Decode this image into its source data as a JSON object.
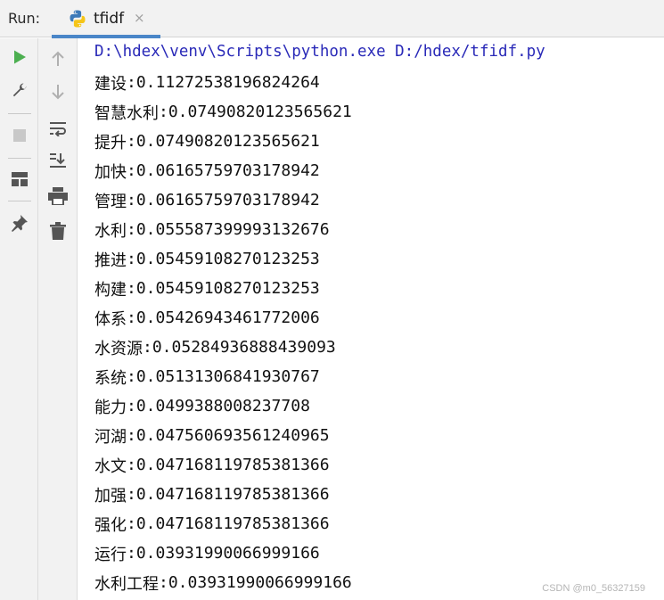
{
  "run_label": "Run:",
  "tab": {
    "title": "tfidf",
    "close": "×",
    "icon": "python-icon"
  },
  "left_toolbar": [
    "run-icon",
    "wrench-icon",
    "stop-icon",
    "layout-icon",
    "pin-icon"
  ],
  "right_toolbar": [
    "arrow-up-icon",
    "arrow-down-icon",
    "soft-wrap-icon",
    "scroll-to-end-icon",
    "print-icon",
    "trash-icon"
  ],
  "console": {
    "command": "D:\\hdex\\venv\\Scripts\\python.exe D:/hdex/tfidf.py",
    "lines": [
      {
        "term": "建设",
        "value": "0.11272538196824264"
      },
      {
        "term": "智慧水利",
        "value": "0.07490820123565621"
      },
      {
        "term": "提升",
        "value": "0.07490820123565621"
      },
      {
        "term": "加快",
        "value": "0.06165759703178942"
      },
      {
        "term": "管理",
        "value": "0.06165759703178942"
      },
      {
        "term": "水利",
        "value": "0.055587399993132676"
      },
      {
        "term": "推进",
        "value": "0.05459108270123253"
      },
      {
        "term": "构建",
        "value": "0.05459108270123253"
      },
      {
        "term": "体系",
        "value": "0.05426943461772006"
      },
      {
        "term": "水资源",
        "value": "0.05284936888439093"
      },
      {
        "term": "系统",
        "value": "0.05131306841930767"
      },
      {
        "term": "能力",
        "value": "0.0499388008237708"
      },
      {
        "term": "河湖",
        "value": "0.047560693561240965"
      },
      {
        "term": "水文",
        "value": "0.047168119785381366"
      },
      {
        "term": "加强",
        "value": "0.047168119785381366"
      },
      {
        "term": "强化",
        "value": "0.047168119785381366"
      },
      {
        "term": "运行",
        "value": "0.03931990066999166"
      },
      {
        "term": "水利工程",
        "value": "0.03931990066999166"
      }
    ]
  },
  "watermark": "CSDN @m0_56327159",
  "colors": {
    "command": "#2a2ab8",
    "run_green": "#4caf50",
    "tab_underline": "#4a86c8"
  }
}
